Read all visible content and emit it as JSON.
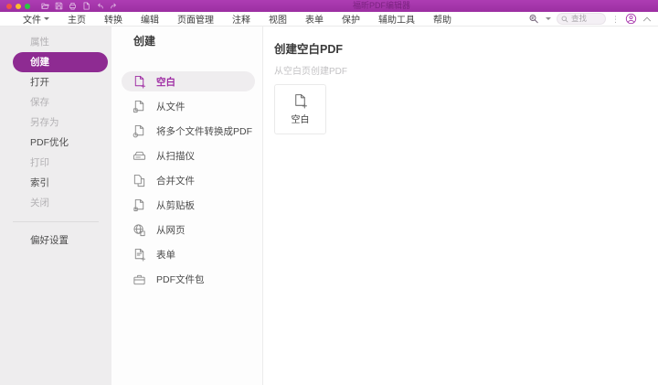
{
  "window": {
    "title": "福昕PDF编辑器"
  },
  "titlebar": {
    "quick_access_icons": [
      "open-folder-icon",
      "save-icon",
      "print-icon",
      "new-document-icon",
      "undo-icon",
      "redo-icon"
    ]
  },
  "menubar": {
    "items": [
      {
        "label": "文件"
      },
      {
        "label": "主页"
      },
      {
        "label": "转换"
      },
      {
        "label": "编辑"
      },
      {
        "label": "页面管理"
      },
      {
        "label": "注释"
      },
      {
        "label": "视图"
      },
      {
        "label": "表单"
      },
      {
        "label": "保护"
      },
      {
        "label": "辅助工具"
      },
      {
        "label": "帮助"
      }
    ],
    "search": {
      "placeholder": "查找"
    },
    "right_icons": [
      "find-replace-icon",
      "search-icon",
      "more-dots-icon",
      "account-icon",
      "collapse-chevron-icon"
    ]
  },
  "sidebar": {
    "items": [
      {
        "label": "属性",
        "state": "disabled"
      },
      {
        "label": "创建",
        "state": "selected"
      },
      {
        "label": "打开",
        "state": "normal"
      },
      {
        "label": "保存",
        "state": "disabled"
      },
      {
        "label": "另存为",
        "state": "disabled"
      },
      {
        "label": "PDF优化",
        "state": "normal"
      },
      {
        "label": "打印",
        "state": "disabled"
      },
      {
        "label": "索引",
        "state": "normal"
      },
      {
        "label": "关闭",
        "state": "disabled"
      }
    ],
    "footer_item": {
      "label": "偏好设置"
    }
  },
  "create_panel": {
    "title": "创建",
    "items": [
      {
        "label": "空白",
        "icon": "blank-page-plus-icon",
        "selected": true
      },
      {
        "label": "从文件",
        "icon": "page-from-file-icon"
      },
      {
        "label": "将多个文件转换成PDF",
        "icon": "convert-multiple-files-icon"
      },
      {
        "label": "从扫描仪",
        "icon": "scanner-icon"
      },
      {
        "label": "合并文件",
        "icon": "combine-files-icon"
      },
      {
        "label": "从剪贴板",
        "icon": "clipboard-icon"
      },
      {
        "label": "从网页",
        "icon": "web-page-icon"
      },
      {
        "label": "表单",
        "icon": "form-icon"
      },
      {
        "label": "PDF文件包",
        "icon": "pdf-portfolio-icon"
      }
    ]
  },
  "detail_panel": {
    "title": "创建空白PDF",
    "subtitle": "从空白页创建PDF",
    "card": {
      "label": "空白",
      "icon": "blank-page-plus-icon"
    }
  },
  "colors": {
    "titlebar": "#9c2fa2",
    "selected_pill": "#8e2b92",
    "selected_item_text": "#9e2ba3",
    "sidebar_bg": "#eeedee"
  }
}
